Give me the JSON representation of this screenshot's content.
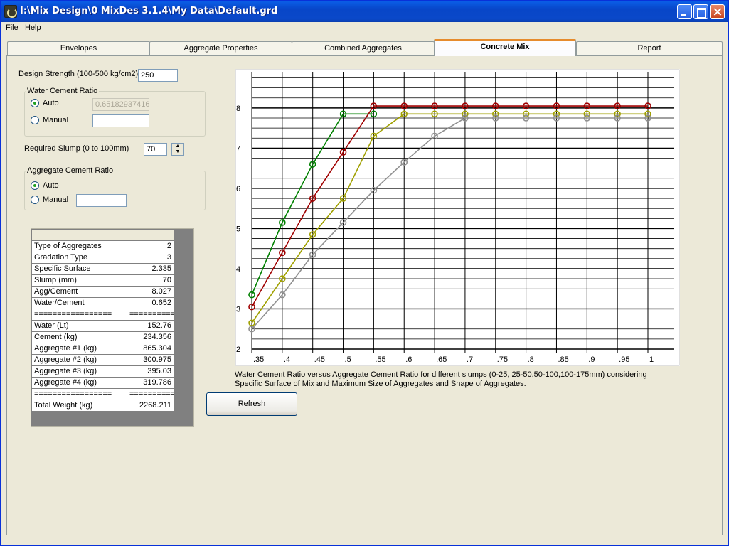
{
  "window": {
    "title": "I:\\Mix Design\\0 MixDes 3.1.4\\My Data\\Default.grd"
  },
  "menu": {
    "file": "File",
    "help": "Help"
  },
  "tabs": [
    "Envelopes",
    "Aggregate Properties",
    "Combined Aggregates",
    "Concrete Mix",
    "Report"
  ],
  "active_tab": "Concrete Mix",
  "form": {
    "design_strength_label": "Design Strength (100-500 kg/cm2)",
    "design_strength_value": "250",
    "wcr_group": "Water Cement Ratio",
    "wcr_auto": "Auto",
    "wcr_auto_value": "0.65182937416",
    "wcr_manual": "Manual",
    "wcr_manual_value": "",
    "slump_label": "Required Slump (0 to 100mm)",
    "slump_value": "70",
    "acr_group": "Aggregate Cement Ratio",
    "acr_auto": "Auto",
    "acr_manual": "Manual",
    "acr_manual_value": ""
  },
  "results": {
    "rows": [
      [
        "",
        ""
      ],
      [
        "Type of Aggregates",
        "2"
      ],
      [
        "Gradation Type",
        "3"
      ],
      [
        " Specific Surface",
        "2.335"
      ],
      [
        "Slump (mm)",
        "70"
      ],
      [
        "Agg/Cement",
        "8.027"
      ],
      [
        "Water/Cement",
        "0.652"
      ],
      [
        "=================",
        "=========="
      ],
      [
        "Water (Lt)",
        "152.76"
      ],
      [
        "Cement (kg)",
        "234.356"
      ],
      [
        "Aggregate #1 (kg)",
        "865.304"
      ],
      [
        "Aggregate #2 (kg)",
        "300.975"
      ],
      [
        "Aggregate #3 (kg)",
        "395.03"
      ],
      [
        "Aggregate #4 (kg)",
        "319.786"
      ],
      [
        "=================",
        "=========="
      ],
      [
        "Total Weight (kg)",
        "2268.211"
      ]
    ]
  },
  "refresh_button": "Refresh",
  "caption": "Water Cement Ratio versus Aggregate Cement Ratio for different slumps (0-25, 25-50,50-100,100-175mm) considering Specific Surface of Mix and Maximum Size of Aggregates and Shape of Aggregates.",
  "colors": {
    "green": "#008000",
    "red": "#a00000",
    "olive": "#a0a000",
    "gray": "#909090"
  },
  "chart_data": {
    "type": "line",
    "title": "",
    "xlabel": "",
    "ylabel": "",
    "xlim": [
      0.35,
      1.0
    ],
    "ylim": [
      2,
      8.9
    ],
    "x_ticks": [
      ".35",
      ".4",
      ".45",
      ".5",
      ".55",
      ".6",
      ".65",
      ".7",
      ".75",
      ".8",
      ".85",
      ".9",
      ".95",
      "1"
    ],
    "y_ticks": [
      "2",
      "3",
      "4",
      "5",
      "6",
      "7",
      "8"
    ],
    "x": [
      0.35,
      0.4,
      0.45,
      0.5,
      0.55,
      0.6,
      0.65,
      0.7,
      0.75,
      0.8,
      0.85,
      0.9,
      0.95,
      1.0
    ],
    "series": [
      {
        "color": "#008000",
        "values": [
          3.35,
          5.15,
          6.6,
          7.85,
          7.85,
          null,
          null,
          null,
          null,
          null,
          null,
          null,
          null,
          null
        ]
      },
      {
        "color": "#a00000",
        "values": [
          3.05,
          4.4,
          5.75,
          6.9,
          8.05,
          8.05,
          8.05,
          8.05,
          8.05,
          8.05,
          8.05,
          8.05,
          8.05,
          8.05
        ]
      },
      {
        "color": "#a0a000",
        "values": [
          2.65,
          3.75,
          4.85,
          5.75,
          7.3,
          7.85,
          7.85,
          7.85,
          7.85,
          7.85,
          7.85,
          7.85,
          7.85,
          7.85
        ]
      },
      {
        "color": "#909090",
        "values": [
          2.5,
          3.35,
          4.35,
          5.15,
          5.95,
          6.65,
          7.3,
          7.75,
          7.75,
          7.75,
          7.75,
          7.75,
          7.75,
          7.75
        ]
      }
    ]
  }
}
